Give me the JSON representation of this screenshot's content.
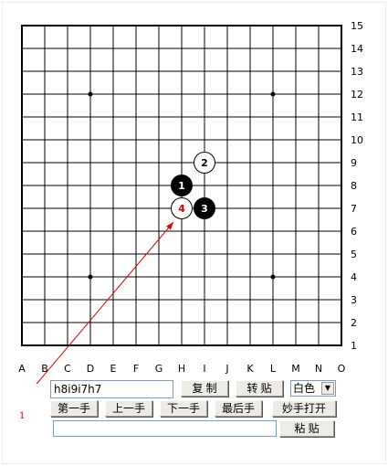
{
  "board": {
    "size": 15,
    "col_labels": [
      "A",
      "B",
      "C",
      "D",
      "E",
      "F",
      "G",
      "H",
      "I",
      "J",
      "K",
      "L",
      "M",
      "N",
      "O"
    ],
    "row_labels": [
      "1",
      "2",
      "3",
      "4",
      "5",
      "6",
      "7",
      "8",
      "9",
      "10",
      "11",
      "12",
      "13",
      "14",
      "15"
    ],
    "star_points": [
      [
        "D",
        4
      ],
      [
        "L",
        4
      ],
      [
        "D",
        12
      ],
      [
        "L",
        12
      ]
    ],
    "stones": [
      {
        "col": "H",
        "row": 8,
        "color": "black",
        "number": "1"
      },
      {
        "col": "I",
        "row": 9,
        "color": "white",
        "number": "2"
      },
      {
        "col": "I",
        "row": 7,
        "color": "black",
        "number": "3"
      },
      {
        "col": "H",
        "row": 7,
        "color": "white",
        "number": "4",
        "highlight": true
      }
    ],
    "arrow": {
      "from_label": "move-counter",
      "to": {
        "col": "H",
        "row": 6.6
      }
    }
  },
  "move_counter": "1",
  "controls": {
    "record_value": "h8i9i7h7",
    "copy_label": "复 制",
    "convert_label": "转 贴",
    "color_select": "白色",
    "first_label": "第一手",
    "prev_label": "上一手",
    "next_label": "下一手",
    "last_label": "最后手",
    "open_label": "妙手打开",
    "paste_value": "",
    "paste_label": "粘 贴"
  },
  "colors": {
    "line": "#000000",
    "highlight_number": "#e00000",
    "arrow": "#e00000"
  }
}
